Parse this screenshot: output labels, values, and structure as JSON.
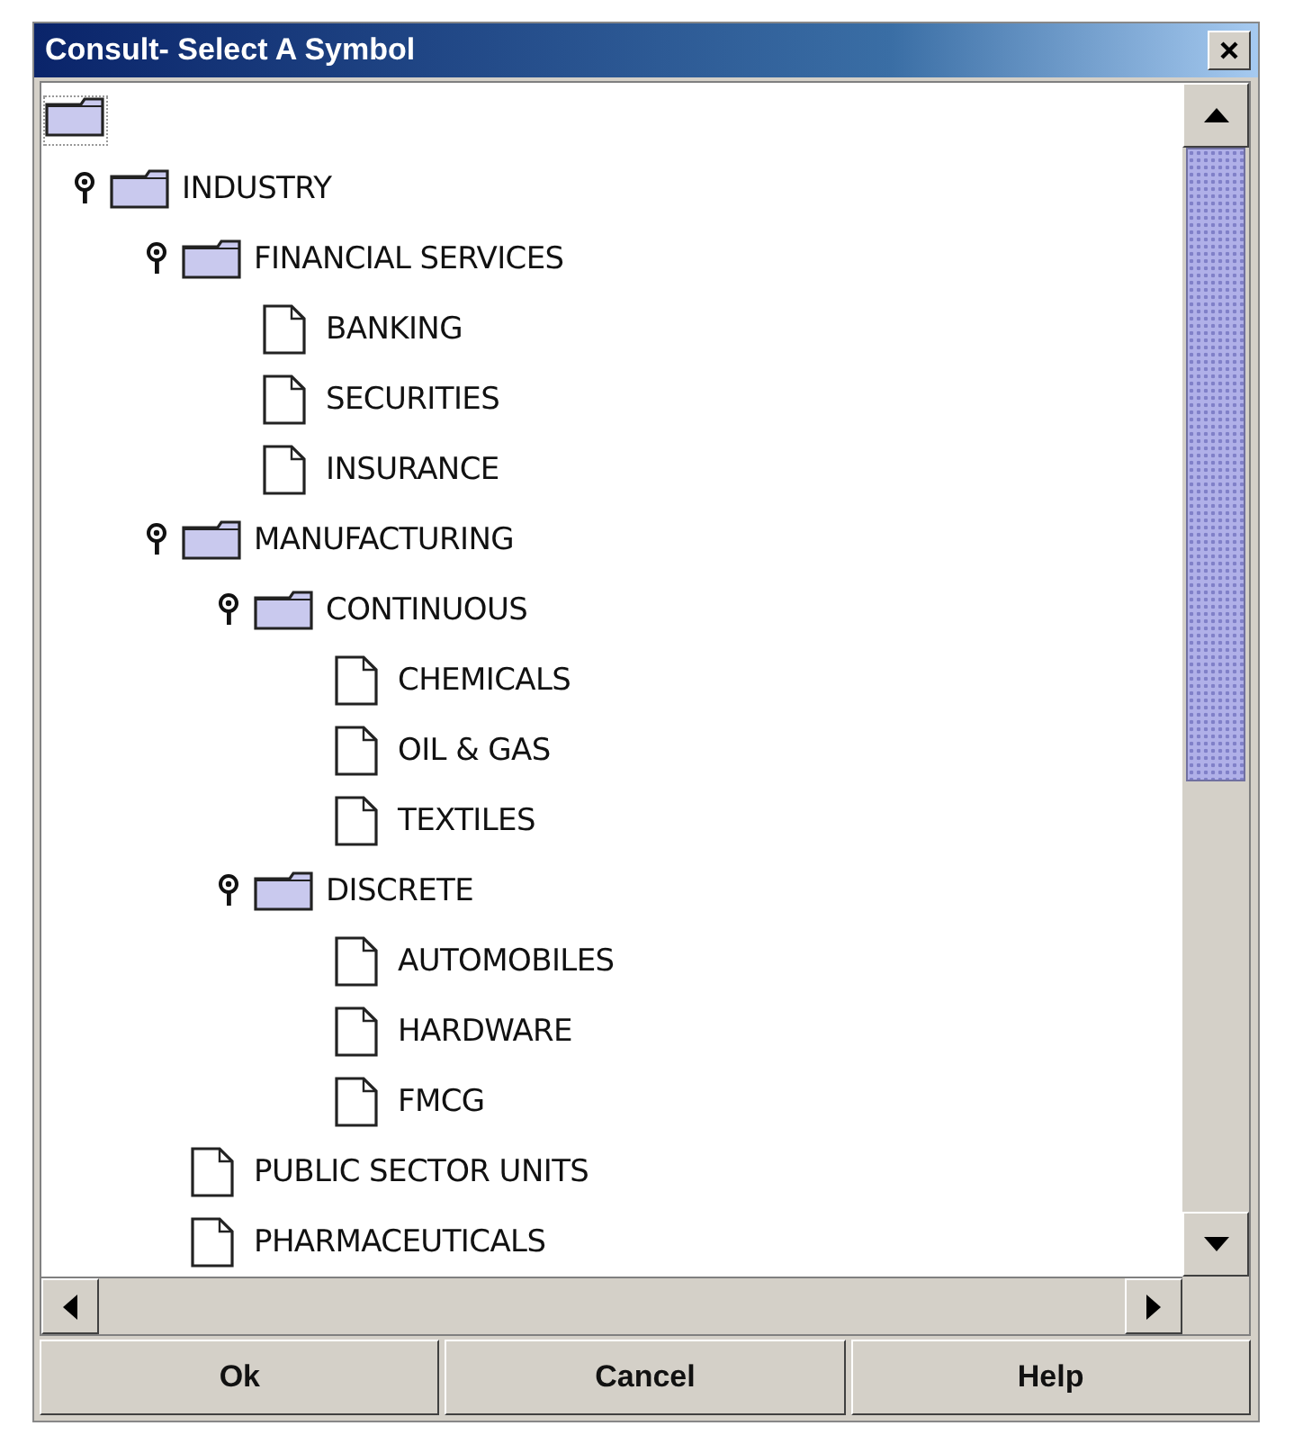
{
  "window": {
    "title": "Consult- Select A Symbol"
  },
  "tree": {
    "items": [
      {
        "label": "INDUSTRY",
        "kind": "folder",
        "expanded": true,
        "children": [
          {
            "label": "FINANCIAL SERVICES",
            "kind": "folder",
            "expanded": true,
            "children": [
              {
                "label": "BANKING",
                "kind": "leaf"
              },
              {
                "label": "SECURITIES",
                "kind": "leaf"
              },
              {
                "label": "INSURANCE",
                "kind": "leaf"
              }
            ]
          },
          {
            "label": "MANUFACTURING",
            "kind": "folder",
            "expanded": true,
            "children": [
              {
                "label": "CONTINUOUS",
                "kind": "folder",
                "expanded": true,
                "children": [
                  {
                    "label": "CHEMICALS",
                    "kind": "leaf"
                  },
                  {
                    "label": "OIL & GAS",
                    "kind": "leaf"
                  },
                  {
                    "label": "TEXTILES",
                    "kind": "leaf"
                  }
                ]
              },
              {
                "label": "DISCRETE",
                "kind": "folder",
                "expanded": true,
                "children": [
                  {
                    "label": "AUTOMOBILES",
                    "kind": "leaf"
                  },
                  {
                    "label": "HARDWARE",
                    "kind": "leaf"
                  },
                  {
                    "label": "FMCG",
                    "kind": "leaf"
                  }
                ]
              }
            ]
          },
          {
            "label": "PUBLIC SECTOR UNITS",
            "kind": "leaf"
          },
          {
            "label": "PHARMACEUTICALS",
            "kind": "leaf"
          }
        ]
      }
    ]
  },
  "buttons": [
    "Ok",
    "Cancel",
    "Help"
  ]
}
